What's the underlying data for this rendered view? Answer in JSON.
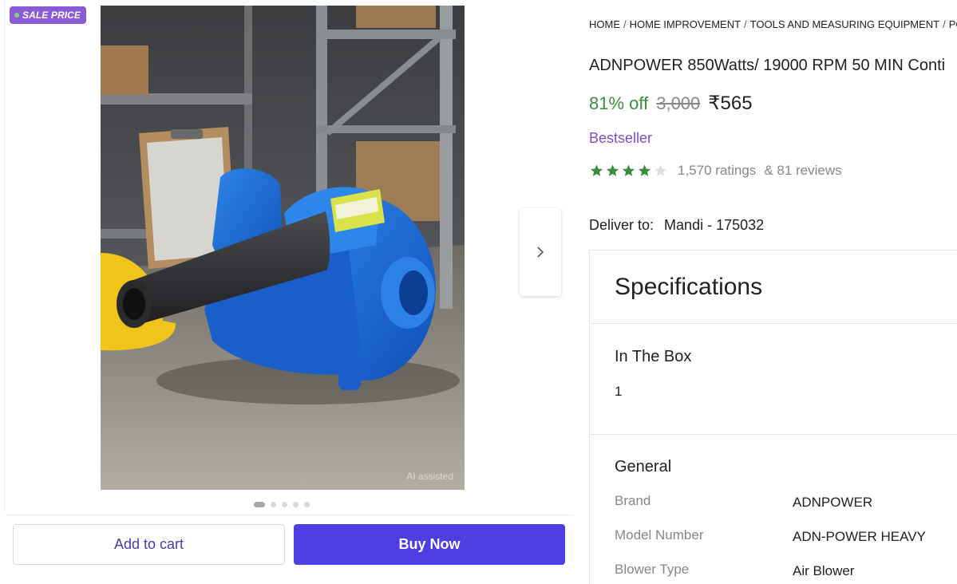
{
  "badge": {
    "label": "SALE PRICE"
  },
  "gallery": {
    "ai_label": "AI assisted",
    "dots": 5,
    "active_dot": 0,
    "next_icon": "chevron-right-icon"
  },
  "actions": {
    "add_to_cart": "Add to cart",
    "buy_now": "Buy Now"
  },
  "breadcrumb": [
    "HOME",
    "HOME IMPROVEMENT",
    "TOOLS AND MEASURING EQUIPMENT",
    "POW"
  ],
  "product": {
    "title": "ADNPOWER 850Watts/ 19000 RPM 50 MIN Conti",
    "discount": "81% off",
    "mrp": "3,000",
    "price": "₹565",
    "tag": "Bestseller",
    "rating_stars": 4,
    "ratings": "1,570 ratings",
    "reviews": "& 81 reviews"
  },
  "delivery": {
    "label": "Deliver to:",
    "location": "Mandi - 175032"
  },
  "specs": {
    "title": "Specifications",
    "in_the_box": {
      "title": "In The Box",
      "value": "1"
    },
    "general": {
      "title": "General",
      "rows": [
        {
          "key": "Brand",
          "value": "ADNPOWER"
        },
        {
          "key": "Model Number",
          "value": "ADN-POWER HEAVY"
        },
        {
          "key": "Blower Type",
          "value": "Air Blower"
        }
      ]
    }
  },
  "colors": {
    "accent": "#4c3ee0",
    "badge": "#8a5bd6",
    "discount": "#388e3c",
    "stars": "#388e3c",
    "bestseller": "#7b4fc0"
  }
}
